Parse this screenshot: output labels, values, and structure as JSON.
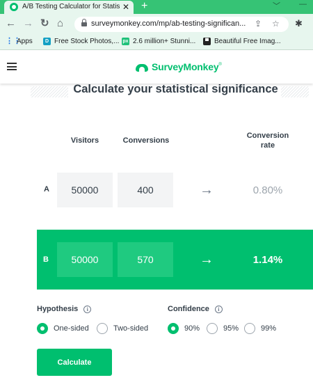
{
  "browser": {
    "tab_title": "A/B Testing Calculator for Statisti",
    "tab_close": "✕",
    "new_tab": "+",
    "minimize": "﹀",
    "close": "—",
    "url": "surveymonkey.com/mp/ab-testing-significan...",
    "bookmarks": [
      {
        "label": "Apps",
        "icon": "apps-grid-icon"
      },
      {
        "label": "Free Stock Photos,...",
        "icon": "d-icon"
      },
      {
        "label": "2.6 million+ Stunni...",
        "icon": "px-icon"
      },
      {
        "label": "Beautiful Free Imag...",
        "icon": "camera-icon"
      }
    ],
    "colors": {
      "tabbar": "#36c375",
      "toolbar": "#e7f6ee"
    }
  },
  "site": {
    "logo_text": "SurveyMonkey",
    "logo_tm": "®",
    "brand_color": "#00bf6f"
  },
  "calculator": {
    "title": "Calculate your statistical significance",
    "columns": {
      "visitors": "Visitors",
      "conversions": "Conversions",
      "conversion_rate_line1": "Conversion",
      "conversion_rate_line2": "rate"
    },
    "rows": [
      {
        "label": "A",
        "visitors": "50000",
        "conversions": "400",
        "rate": "0.80%"
      },
      {
        "label": "B",
        "visitors": "50000",
        "conversions": "570",
        "rate": "1.14%"
      }
    ],
    "arrow": "→",
    "hypothesis": {
      "label": "Hypothesis",
      "options": [
        "One-sided",
        "Two-sided"
      ],
      "selected": "One-sided"
    },
    "confidence": {
      "label": "Confidence",
      "options": [
        "90%",
        "95%",
        "99%"
      ],
      "selected": "90%"
    },
    "info_glyph": "i",
    "calculate_label": "Calculate"
  }
}
